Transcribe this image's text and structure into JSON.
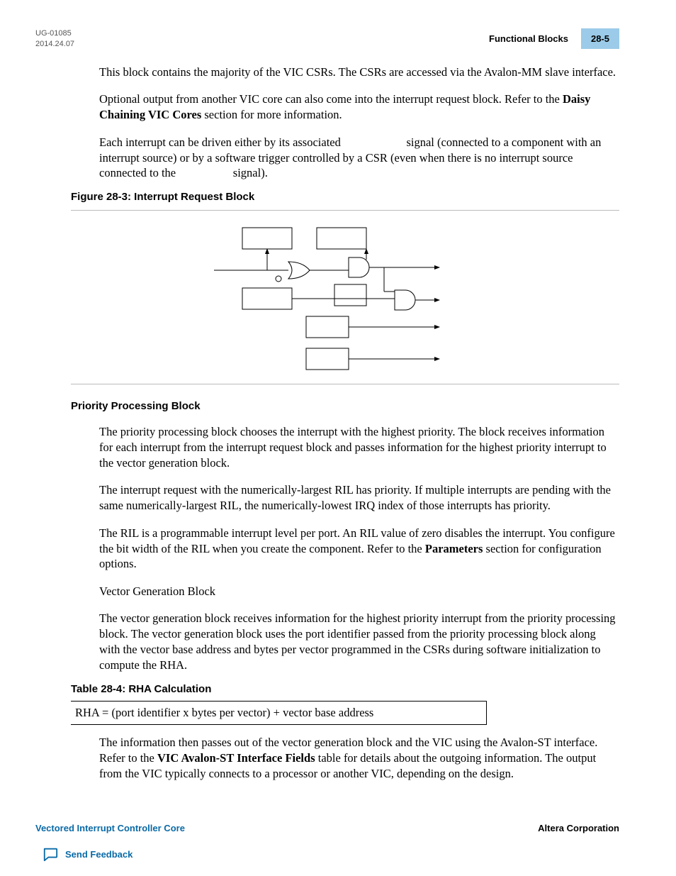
{
  "header": {
    "doc_id": "UG-01085",
    "date": "2014.24.07",
    "section_title": "Functional Blocks",
    "page_num": "28-5"
  },
  "paragraphs": {
    "p1": "This block contains the majority of the VIC CSRs. The CSRs are accessed via the Avalon-MM slave interface.",
    "p2a": "Optional output from another VIC core can also come into the interrupt request block. Refer to the ",
    "p2b": "Daisy Chaining VIC Cores",
    "p2c": " section for more information.",
    "p3a": "Each interrupt can be driven either by its associated ",
    "p3b": " signal (connected to a component with an interrupt source) or by a software trigger controlled by a CSR (even when there is no interrupt source connected to the ",
    "p3c": " signal).",
    "p4": "The priority processing block chooses the interrupt with the highest priority. The block receives information for each interrupt from the interrupt request block and passes information for the highest priority interrupt to the vector generation block.",
    "p5": "The interrupt request with the numerically-largest RIL has priority. If multiple interrupts are pending with the same numerically-largest RIL, the numerically-lowest IRQ index of those interrupts has priority.",
    "p6a": "The RIL is a programmable interrupt level per port. An RIL value of zero disables the interrupt. You configure the bit width of the RIL when you create the component. Refer to the ",
    "p6b": "Parameters",
    "p6c": " section for configuration options.",
    "p7": "Vector Generation Block",
    "p8": "The vector generation block receives information for the highest priority interrupt from the priority processing block. The vector generation block uses the port identifier passed from the priority processing block along with the vector base address and bytes per vector programmed in the CSRs during software initialization to compute the RHA.",
    "p9a": "The information then passes out of the vector generation block and the VIC using the Avalon-ST interface. Refer to the ",
    "p9b": "VIC Avalon-ST Interface Fields",
    "p9c": " table for details about the outgoing information. The output from the VIC typically connects to a processor or another VIC, depending on the design."
  },
  "captions": {
    "fig": "Figure 28-3: Interrupt Request Block",
    "section": "Priority Processing Block",
    "table": "Table 28-4: RHA Calculation"
  },
  "table": {
    "cell": "RHA = (port identifier x bytes per vector) + vector base address"
  },
  "footer": {
    "left": "Vectored Interrupt Controller Core",
    "right": "Altera Corporation",
    "feedback": "Send Feedback"
  }
}
